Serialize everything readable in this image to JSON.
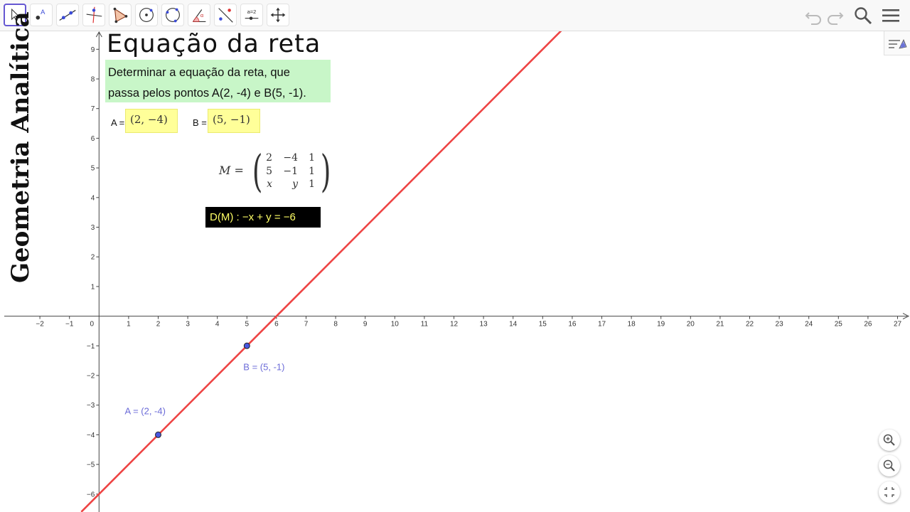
{
  "toolbar": {
    "tools": [
      {
        "name": "move-tool",
        "x": 5,
        "active": true
      },
      {
        "name": "point-tool",
        "x": 42
      },
      {
        "name": "line-tool",
        "x": 79
      },
      {
        "name": "perpendicular-line-tool",
        "x": 116
      },
      {
        "name": "polygon-tool",
        "x": 153
      },
      {
        "name": "circle-center-point-tool",
        "x": 190
      },
      {
        "name": "circle-three-points-tool",
        "x": 227
      },
      {
        "name": "angle-tool",
        "x": 264
      },
      {
        "name": "reflect-tool",
        "x": 301
      },
      {
        "name": "slider-tool",
        "x": 338,
        "label": "a=2"
      },
      {
        "name": "move-graphics-view-tool",
        "x": 375
      }
    ],
    "slider_label": "a=2"
  },
  "title": "Equação da reta",
  "side_title": "Geometria Analítica",
  "statement": {
    "line1": "Determinar a equação da reta, que",
    "line2": "passa pelos pontos A(2, -4) e B(5, -1)."
  },
  "inputs": {
    "a_label": "A =",
    "a_value": "(2, −4)",
    "b_label": "B =",
    "b_value": "(5, −1)"
  },
  "matrix": {
    "label": "M =",
    "rows": [
      [
        "2",
        "−4",
        "1"
      ],
      [
        "5",
        "−1",
        "1"
      ],
      [
        "x",
        "y",
        "1"
      ]
    ]
  },
  "determinant": "D(M) :  −x + y  =  −6",
  "graph": {
    "x_ticks": [
      -2,
      -1,
      0,
      1,
      2,
      3,
      4,
      5,
      6,
      7,
      8,
      9,
      10,
      11,
      12,
      13,
      14,
      15,
      16,
      17,
      18,
      19,
      20,
      21,
      22,
      23,
      24,
      25,
      26,
      27
    ],
    "y_ticks": [
      9,
      8,
      7,
      6,
      5,
      4,
      3,
      2,
      1,
      -1,
      -2,
      -3,
      -4,
      -5,
      -6
    ],
    "points": [
      {
        "name": "A",
        "x": 2,
        "y": -4,
        "label": "A = (2, -4)"
      },
      {
        "name": "B",
        "x": 5,
        "y": -1,
        "label": "B = (5, -1)"
      }
    ],
    "line": {
      "equation": "-x + y = -6",
      "color": "#ee4444"
    },
    "point_color": "#4a57e0",
    "label_color": "#6c6cd8"
  }
}
